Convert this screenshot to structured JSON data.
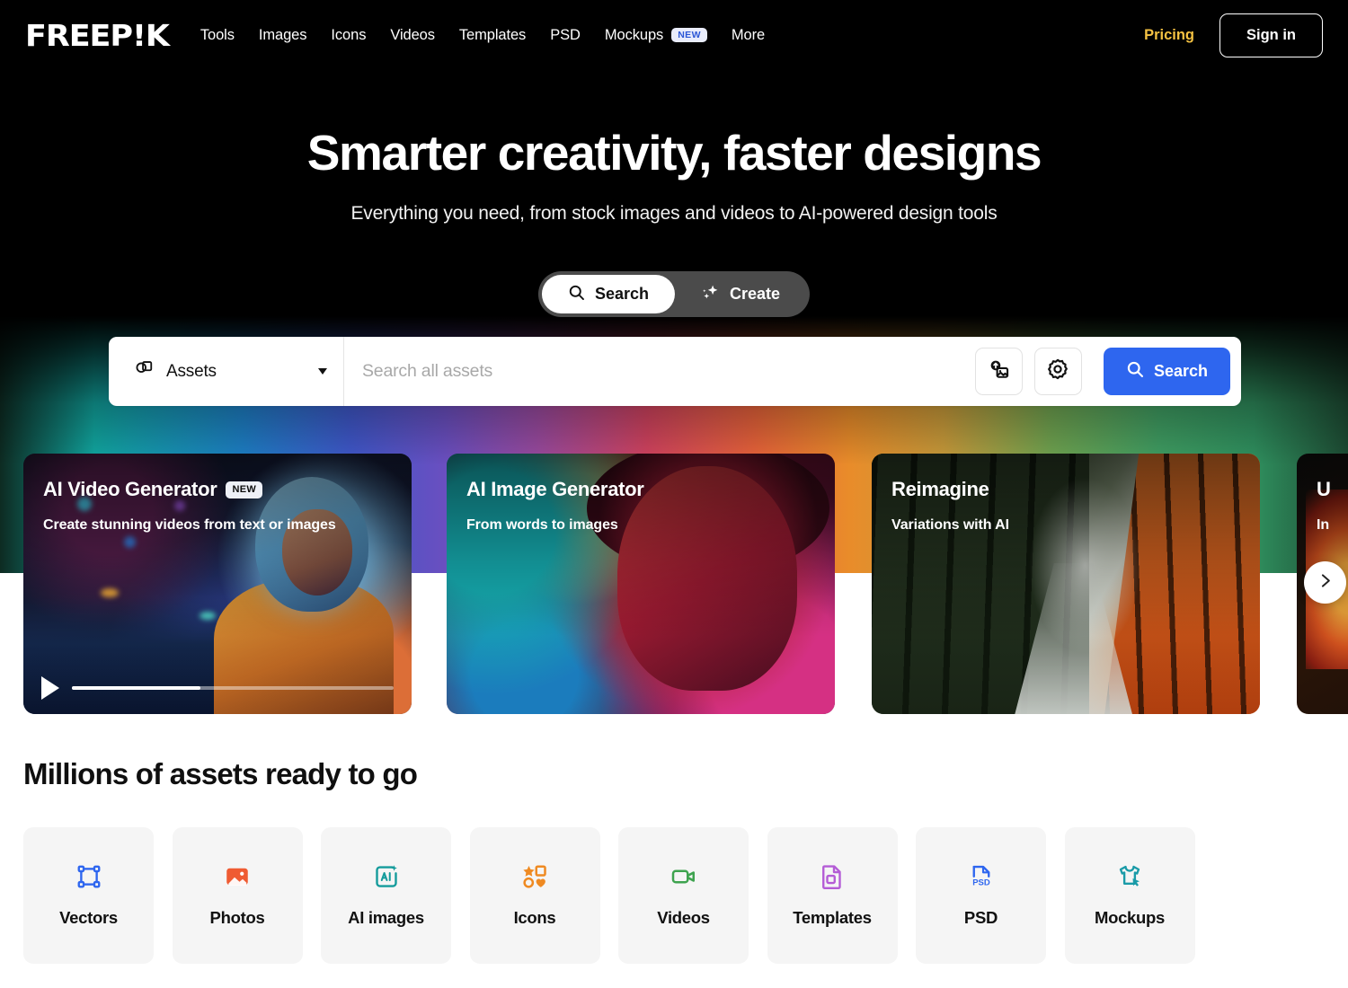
{
  "nav": {
    "logo": "FREEP!K",
    "links": [
      {
        "label": "Tools"
      },
      {
        "label": "Images"
      },
      {
        "label": "Icons"
      },
      {
        "label": "Videos"
      },
      {
        "label": "Templates"
      },
      {
        "label": "PSD"
      },
      {
        "label": "Mockups",
        "badge": "NEW"
      },
      {
        "label": "More"
      }
    ],
    "pricing": "Pricing",
    "signin": "Sign in"
  },
  "hero": {
    "title": "Smarter creativity, faster designs",
    "subtitle": "Everything you need, from stock images and videos to AI-powered design tools",
    "modes": [
      {
        "label": "Search",
        "icon": "search-icon",
        "active": true
      },
      {
        "label": "Create",
        "icon": "sparkles-icon",
        "active": false
      }
    ]
  },
  "search": {
    "category_label": "Assets",
    "category_icon": "assets-icon",
    "placeholder": "Search all assets",
    "value": "",
    "upload_icon": "image-upload-icon",
    "settings_icon": "gear-icon",
    "button_label": "Search",
    "button_color": "#2e66ef"
  },
  "cards": [
    {
      "title": "AI Video Generator",
      "badge": "NEW",
      "subtitle": "Create stunning videos from text or images",
      "has_video": true,
      "progress": 40
    },
    {
      "title": "AI Image Generator",
      "badge": "",
      "subtitle": "From words to images",
      "has_video": false,
      "progress": 0
    },
    {
      "title": "Reimagine",
      "badge": "",
      "subtitle": "Variations with AI",
      "has_video": false,
      "progress": 0
    },
    {
      "title": "U",
      "badge": "",
      "subtitle": "In",
      "has_video": false,
      "progress": 0
    }
  ],
  "carousel": {
    "next_icon": "chevron-right-icon"
  },
  "assets": {
    "heading": "Millions of assets ready to go",
    "tiles": [
      {
        "label": "Vectors",
        "icon": "vectors-icon",
        "color": "#2e66ef"
      },
      {
        "label": "Photos",
        "icon": "photo-icon",
        "color": "#ef5b32"
      },
      {
        "label": "AI images",
        "icon": "ai-image-icon",
        "color": "#149b9b"
      },
      {
        "label": "Icons",
        "icon": "shapes-icon",
        "color": "#ef8a22"
      },
      {
        "label": "Videos",
        "icon": "video-camera-icon",
        "color": "#3ea34f"
      },
      {
        "label": "Templates",
        "icon": "template-doc-icon",
        "color": "#b45cd6"
      },
      {
        "label": "PSD",
        "icon": "psd-file-icon",
        "color": "#2e66ef"
      },
      {
        "label": "Mockups",
        "icon": "tshirt-cursor-icon",
        "color": "#1a9ba8"
      }
    ]
  }
}
